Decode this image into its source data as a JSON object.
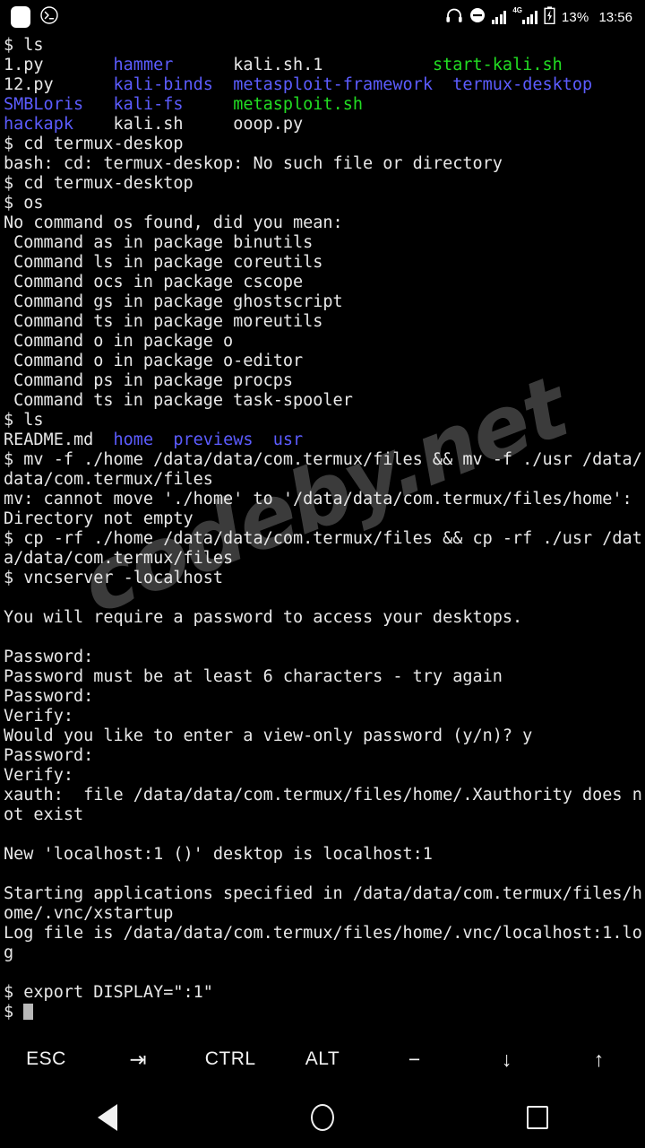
{
  "statusbar": {
    "left_icons": [
      {
        "name": "app-square-icon",
        "glyph": "square"
      },
      {
        "name": "termux-notification-icon",
        "glyph": "terminal-circle"
      }
    ],
    "headphone_icon": "headphone-icon",
    "dnd_icon": "do-not-disturb-icon",
    "signal_icon": "signal-bars-icon",
    "signal_4g_icon": "signal-4g-bars-icon",
    "lte_label": "4G",
    "battery_icon": "battery-charging-icon",
    "battery_percent": "13%",
    "clock": "13:56"
  },
  "terminal": {
    "prompt": "$",
    "watermark": "codeby.net",
    "lines": [
      {
        "id": "cmd-ls-1",
        "segments": [
          {
            "text": "$ ls",
            "color": "white"
          }
        ]
      },
      {
        "id": "ls-out-row-1",
        "segments": [
          {
            "text": "1.py",
            "color": "white"
          },
          {
            "text": "       ",
            "color": "white"
          },
          {
            "text": "hammer",
            "color": "blue"
          },
          {
            "text": "      ",
            "color": "white"
          },
          {
            "text": "kali.sh.1",
            "color": "white"
          },
          {
            "text": "           ",
            "color": "white"
          },
          {
            "text": "start-kali.sh",
            "color": "green"
          }
        ]
      },
      {
        "id": "ls-out-row-2",
        "segments": [
          {
            "text": "12.py",
            "color": "white"
          },
          {
            "text": "      ",
            "color": "white"
          },
          {
            "text": "kali-binds",
            "color": "blue"
          },
          {
            "text": "  ",
            "color": "white"
          },
          {
            "text": "metasploit-framework",
            "color": "blue"
          },
          {
            "text": "  ",
            "color": "white"
          },
          {
            "text": "termux-desktop",
            "color": "blue"
          }
        ]
      },
      {
        "id": "ls-out-row-3",
        "segments": [
          {
            "text": "SMBLoris",
            "color": "blue"
          },
          {
            "text": "   ",
            "color": "white"
          },
          {
            "text": "kali-fs",
            "color": "blue"
          },
          {
            "text": "     ",
            "color": "white"
          },
          {
            "text": "metasploit.sh",
            "color": "green"
          }
        ]
      },
      {
        "id": "ls-out-row-4",
        "segments": [
          {
            "text": "hackapk",
            "color": "blue"
          },
          {
            "text": "    ",
            "color": "white"
          },
          {
            "text": "kali.sh",
            "color": "white"
          },
          {
            "text": "     ",
            "color": "white"
          },
          {
            "text": "ooop.py",
            "color": "white"
          }
        ]
      },
      {
        "id": "cmd-cd-typo",
        "segments": [
          {
            "text": "$ cd termux-deskop",
            "color": "white"
          }
        ]
      },
      {
        "id": "err-no-such-dir",
        "segments": [
          {
            "text": "bash: cd: termux-deskop: No such file or directory",
            "color": "white"
          }
        ]
      },
      {
        "id": "cmd-cd-desktop",
        "segments": [
          {
            "text": "$ cd termux-desktop",
            "color": "white"
          }
        ]
      },
      {
        "id": "cmd-os",
        "segments": [
          {
            "text": "$ os",
            "color": "white"
          }
        ]
      },
      {
        "id": "out-no-command",
        "segments": [
          {
            "text": "No command os found, did you mean:",
            "color": "white"
          }
        ]
      },
      {
        "id": "suggest-binutils",
        "segments": [
          {
            "text": " Command as in package binutils",
            "color": "white"
          }
        ]
      },
      {
        "id": "suggest-coreutils",
        "segments": [
          {
            "text": " Command ls in package coreutils",
            "color": "white"
          }
        ]
      },
      {
        "id": "suggest-cscope",
        "segments": [
          {
            "text": " Command ocs in package cscope",
            "color": "white"
          }
        ]
      },
      {
        "id": "suggest-ghostscript",
        "segments": [
          {
            "text": " Command gs in package ghostscript",
            "color": "white"
          }
        ]
      },
      {
        "id": "suggest-moreutils",
        "segments": [
          {
            "text": " Command ts in package moreutils",
            "color": "white"
          }
        ]
      },
      {
        "id": "suggest-o",
        "segments": [
          {
            "text": " Command o in package o",
            "color": "white"
          }
        ]
      },
      {
        "id": "suggest-o-editor",
        "segments": [
          {
            "text": " Command o in package o-editor",
            "color": "white"
          }
        ]
      },
      {
        "id": "suggest-procps",
        "segments": [
          {
            "text": " Command ps in package procps",
            "color": "white"
          }
        ]
      },
      {
        "id": "suggest-task-spooler",
        "segments": [
          {
            "text": " Command ts in package task-spooler",
            "color": "white"
          }
        ]
      },
      {
        "id": "cmd-ls-2",
        "segments": [
          {
            "text": "$ ls",
            "color": "white"
          }
        ]
      },
      {
        "id": "ls-out-2",
        "segments": [
          {
            "text": "README.md",
            "color": "white"
          },
          {
            "text": "  ",
            "color": "white"
          },
          {
            "text": "home",
            "color": "blue"
          },
          {
            "text": "  ",
            "color": "white"
          },
          {
            "text": "previews",
            "color": "blue"
          },
          {
            "text": "  ",
            "color": "white"
          },
          {
            "text": "usr",
            "color": "blue"
          }
        ]
      },
      {
        "id": "cmd-mv-1",
        "segments": [
          {
            "text": "$ mv -f ./home /data/data/com.termux/files && mv -f ./usr /data/",
            "color": "white"
          }
        ]
      },
      {
        "id": "cmd-mv-1-wrap",
        "segments": [
          {
            "text": "data/com.termux/files",
            "color": "white"
          }
        ]
      },
      {
        "id": "err-mv-cannot-move",
        "segments": [
          {
            "text": "mv: cannot move './home' to '/data/data/com.termux/files/home':",
            "color": "white"
          }
        ]
      },
      {
        "id": "err-dir-not-empty",
        "segments": [
          {
            "text": "Directory not empty",
            "color": "white"
          }
        ]
      },
      {
        "id": "cmd-cp-1",
        "segments": [
          {
            "text": "$ cp -rf ./home /data/data/com.termux/files && cp -rf ./usr /dat",
            "color": "white"
          }
        ]
      },
      {
        "id": "cmd-cp-1-wrap",
        "segments": [
          {
            "text": "a/data/com.termux/files",
            "color": "white"
          }
        ]
      },
      {
        "id": "cmd-vncserver",
        "segments": [
          {
            "text": "$ vncserver -localhost",
            "color": "white"
          }
        ]
      },
      {
        "id": "blank-1",
        "segments": [
          {
            "text": "",
            "color": "white"
          }
        ]
      },
      {
        "id": "out-require-password",
        "segments": [
          {
            "text": "You will require a password to access your desktops.",
            "color": "white"
          }
        ]
      },
      {
        "id": "blank-2",
        "segments": [
          {
            "text": "",
            "color": "white"
          }
        ]
      },
      {
        "id": "prompt-password-1",
        "segments": [
          {
            "text": "Password:",
            "color": "white"
          }
        ]
      },
      {
        "id": "err-password-short",
        "segments": [
          {
            "text": "Password must be at least 6 characters - try again",
            "color": "white"
          }
        ]
      },
      {
        "id": "prompt-password-2",
        "segments": [
          {
            "text": "Password:",
            "color": "white"
          }
        ]
      },
      {
        "id": "prompt-verify-1",
        "segments": [
          {
            "text": "Verify:",
            "color": "white"
          }
        ]
      },
      {
        "id": "prompt-view-only",
        "segments": [
          {
            "text": "Would you like to enter a view-only password (y/n)? y",
            "color": "white"
          }
        ]
      },
      {
        "id": "prompt-password-3",
        "segments": [
          {
            "text": "Password:",
            "color": "white"
          }
        ]
      },
      {
        "id": "prompt-verify-2",
        "segments": [
          {
            "text": "Verify:",
            "color": "white"
          }
        ]
      },
      {
        "id": "err-xauth",
        "segments": [
          {
            "text": "xauth:  file /data/data/com.termux/files/home/.Xauthority does n",
            "color": "white"
          }
        ]
      },
      {
        "id": "err-xauth-wrap",
        "segments": [
          {
            "text": "ot exist",
            "color": "white"
          }
        ]
      },
      {
        "id": "blank-3",
        "segments": [
          {
            "text": "",
            "color": "white"
          }
        ]
      },
      {
        "id": "out-new-desktop",
        "segments": [
          {
            "text": "New 'localhost:1 ()' desktop is localhost:1",
            "color": "white"
          }
        ]
      },
      {
        "id": "blank-4",
        "segments": [
          {
            "text": "",
            "color": "white"
          }
        ]
      },
      {
        "id": "out-starting-apps",
        "segments": [
          {
            "text": "Starting applications specified in /data/data/com.termux/files/h",
            "color": "white"
          }
        ]
      },
      {
        "id": "out-starting-apps-wrap",
        "segments": [
          {
            "text": "ome/.vnc/xstartup",
            "color": "white"
          }
        ]
      },
      {
        "id": "out-log-file",
        "segments": [
          {
            "text": "Log file is /data/data/com.termux/files/home/.vnc/localhost:1.lo",
            "color": "white"
          }
        ]
      },
      {
        "id": "out-log-file-wrap",
        "segments": [
          {
            "text": "g",
            "color": "white"
          }
        ]
      },
      {
        "id": "blank-5",
        "segments": [
          {
            "text": "",
            "color": "white"
          }
        ]
      },
      {
        "id": "cmd-export-display",
        "segments": [
          {
            "text": "$ export DISPLAY=\":1\"",
            "color": "white"
          }
        ]
      },
      {
        "id": "prompt-current",
        "segments": [
          {
            "text": "$ ",
            "color": "white"
          }
        ],
        "cursor": true
      }
    ]
  },
  "extra_keys": [
    {
      "name": "key-esc",
      "label": "ESC"
    },
    {
      "name": "key-tab",
      "label": "⇥"
    },
    {
      "name": "key-ctrl",
      "label": "CTRL"
    },
    {
      "name": "key-alt",
      "label": "ALT"
    },
    {
      "name": "key-minus",
      "label": "−"
    },
    {
      "name": "key-arrow-down",
      "label": "↓"
    },
    {
      "name": "key-arrow-up",
      "label": "↑"
    }
  ],
  "navbar": [
    {
      "name": "nav-back-button",
      "glyph": "triangle-left"
    },
    {
      "name": "nav-home-button",
      "glyph": "circle"
    },
    {
      "name": "nav-recents-button",
      "glyph": "square"
    }
  ],
  "colors": {
    "background": "#000000",
    "foreground": "#e8e8e8",
    "directory_blue": "#5c5cff",
    "executable_green": "#22dd22",
    "cursor": "#b8b8b8",
    "watermark": "#4a4a4a"
  }
}
